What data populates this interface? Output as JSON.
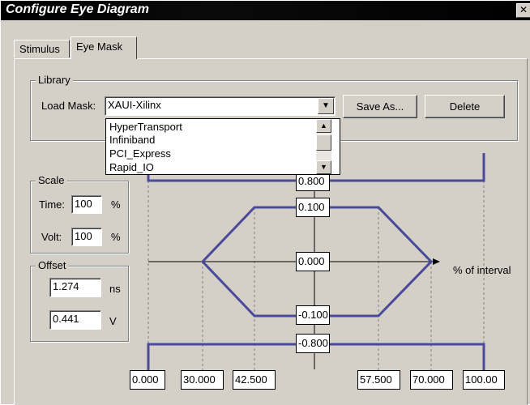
{
  "window": {
    "title": "Configure Eye Diagram",
    "close_glyph": "✕"
  },
  "tabs": [
    {
      "label": "Stimulus",
      "active": false
    },
    {
      "label": "Eye Mask",
      "active": true
    }
  ],
  "library": {
    "group_label": "Library",
    "load_mask_label": "Load Mask:",
    "selected": "XAUI-Xilinx",
    "save_as_label": "Save As...",
    "delete_label": "Delete",
    "dropdown_options": [
      "HyperTransport",
      "Infiniband",
      "PCI_Express",
      "Rapid_IO"
    ]
  },
  "scale": {
    "group_label": "Scale",
    "time_label": "Time:",
    "time_value": "100",
    "time_unit": "%",
    "volt_label": "Volt:",
    "volt_value": "100",
    "volt_unit": "%"
  },
  "offset": {
    "group_label": "Offset",
    "time_value": "1.274",
    "time_unit": "ns",
    "volt_value": "0.441",
    "volt_unit": "V"
  },
  "mask": {
    "axis_label": "% of interval",
    "y_fields": [
      "0.800",
      "0.100",
      "0.000",
      "-0.100",
      "-0.800"
    ],
    "x_fields": [
      "0.000",
      "30.000",
      "42.500",
      "57.500",
      "70.000",
      "100.00"
    ],
    "line_color": "#4a4a9a"
  }
}
